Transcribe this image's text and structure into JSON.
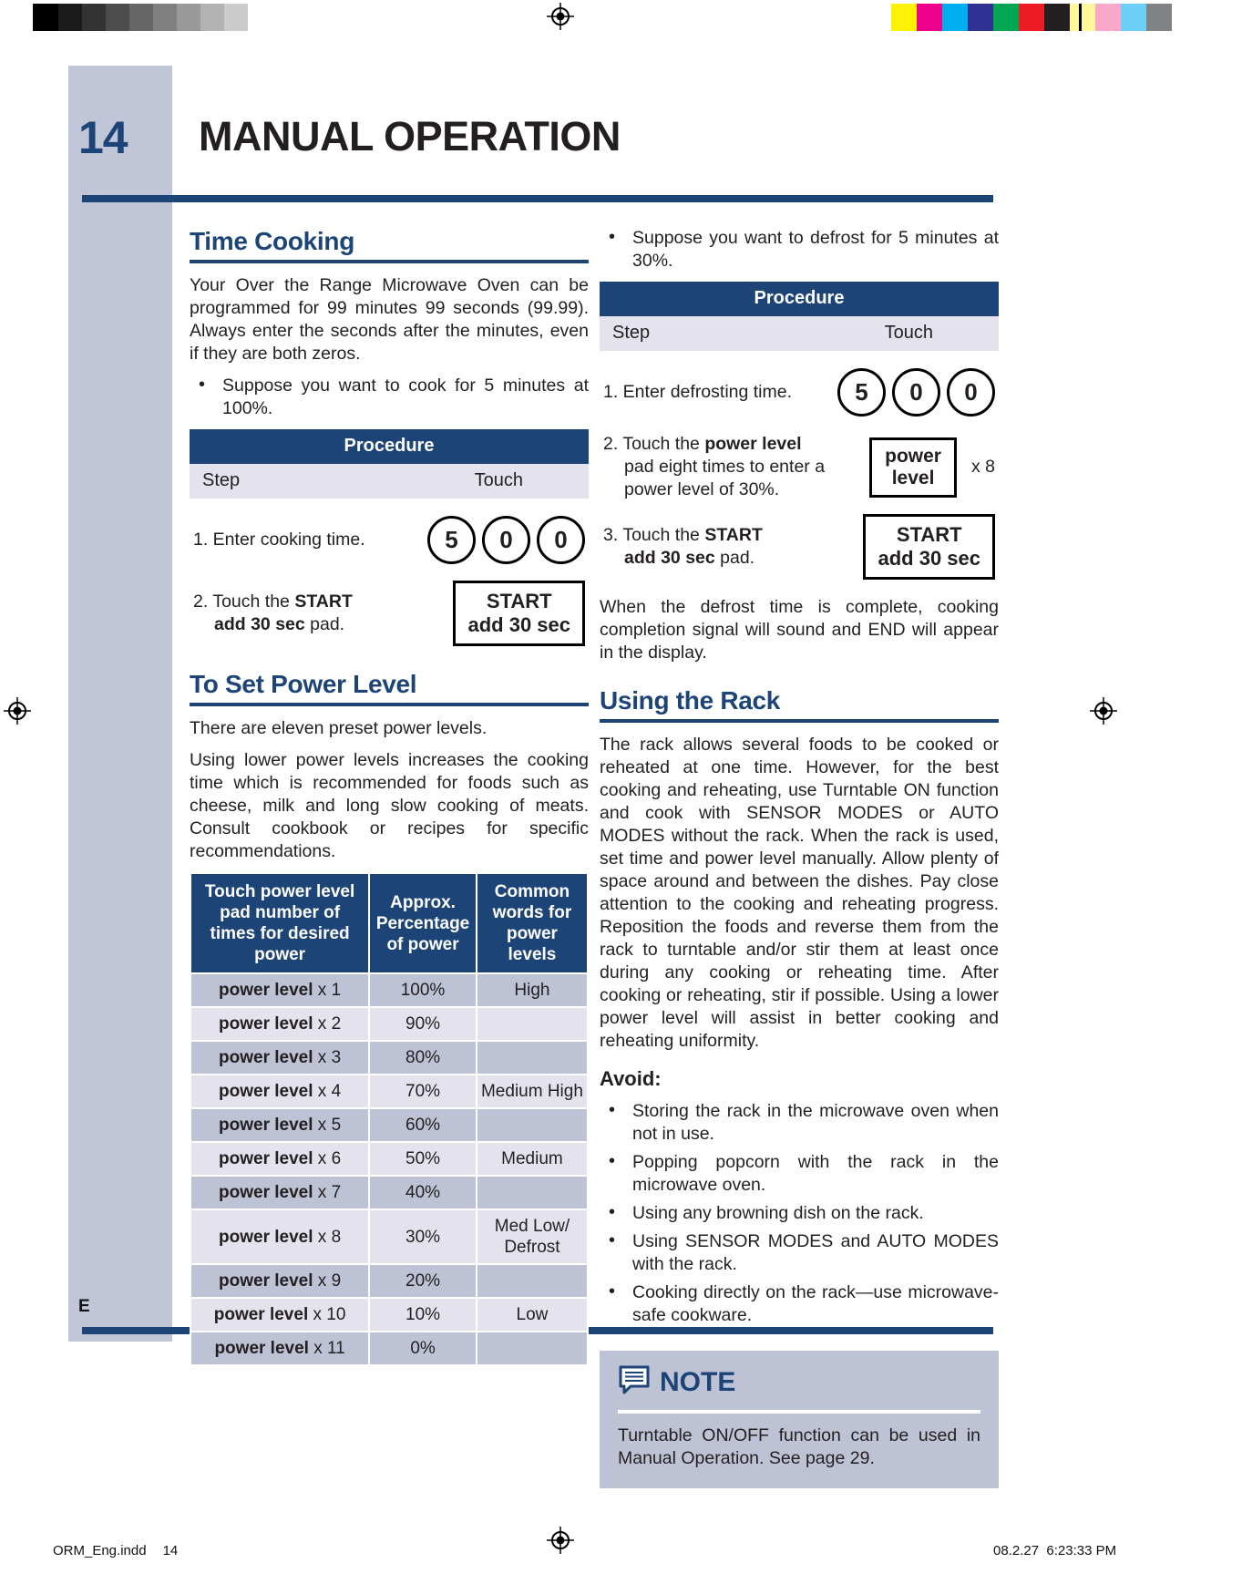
{
  "header": {
    "page_number": "14",
    "title": "MANUAL OPERATION",
    "edge_tab": "E"
  },
  "left_column": {
    "time_cooking": {
      "heading": "Time Cooking",
      "paragraph": "Your Over the Range Microwave Oven can be programmed for 99 minutes 99 seconds (99.99). Always enter the seconds after the minutes, even if they are both zeros.",
      "bullets": [
        "Suppose you want to cook for 5 minutes at 100%."
      ],
      "procedure": {
        "title": "Procedure",
        "col_step": "Step",
        "col_touch": "Touch",
        "rows": [
          {
            "step_text": "1. Enter cooking time.",
            "step_text2": "",
            "touch_type": "circles",
            "keys": [
              "5",
              "0",
              "0"
            ]
          },
          {
            "step_text": "2. Touch the START",
            "step_text2": "add 30 sec pad.",
            "touch_type": "box",
            "box_line1": "START",
            "box_line2": "add 30 sec"
          }
        ]
      }
    },
    "power_level": {
      "heading": "To Set Power Level",
      "paragraph1": "There are eleven preset power levels.",
      "paragraph2": "Using lower power levels increases the cooking time which is recommended for foods such as cheese, milk and long slow cooking of meats. Consult cookbook or recipes for specific recommendations.",
      "table": {
        "headers": [
          "Touch power level pad number of times for desired power",
          "Approx. Percentage of power",
          "Common words for power levels"
        ],
        "rows": [
          {
            "pad": "power level",
            "times": "x 1",
            "percent": "100%",
            "word": "High"
          },
          {
            "pad": "power level",
            "times": "x 2",
            "percent": "90%",
            "word": ""
          },
          {
            "pad": "power level",
            "times": "x 3",
            "percent": "80%",
            "word": ""
          },
          {
            "pad": "power level",
            "times": "x 4",
            "percent": "70%",
            "word": "Medium High"
          },
          {
            "pad": "power level",
            "times": "x 5",
            "percent": "60%",
            "word": ""
          },
          {
            "pad": "power level",
            "times": "x 6",
            "percent": "50%",
            "word": "Medium"
          },
          {
            "pad": "power level",
            "times": "x 7",
            "percent": "40%",
            "word": ""
          },
          {
            "pad": "power level",
            "times": "x 8",
            "percent": "30%",
            "word": "Med Low/ Defrost"
          },
          {
            "pad": "power level",
            "times": "x 9",
            "percent": "20%",
            "word": ""
          },
          {
            "pad": "power level",
            "times": "x 10",
            "percent": "10%",
            "word": "Low"
          },
          {
            "pad": "power level",
            "times": "x 11",
            "percent": "0%",
            "word": ""
          }
        ]
      }
    }
  },
  "right_column": {
    "defrost": {
      "bullets": [
        "Suppose you want to defrost for 5 minutes at 30%."
      ],
      "procedure": {
        "title": "Procedure",
        "col_step": "Step",
        "col_touch": "Touch",
        "rows": [
          {
            "step_text": "1. Enter defrosting time.",
            "step_text2": "",
            "touch_type": "circles",
            "keys": [
              "5",
              "0",
              "0"
            ]
          },
          {
            "step_text": "2. Touch the power level",
            "step_text2": "pad eight times to enter a power level of 30%.",
            "touch_type": "box_times",
            "box_line1": "power",
            "box_line2": "level",
            "times_label": "x 8"
          },
          {
            "step_text": "3. Touch the START",
            "step_text2": "add 30 sec pad.",
            "touch_type": "box",
            "box_line1": "START",
            "box_line2": "add 30 sec"
          }
        ]
      },
      "closing_paragraph": "When the defrost time is complete, cooking completion signal will sound and END will appear in the display."
    },
    "using_rack": {
      "heading": "Using the Rack",
      "paragraph": "The rack allows several foods to be cooked or reheated at one time. However, for the best cooking and reheating, use Turntable ON function and cook with SENSOR MODES or AUTO MODES without the rack. When the rack is used, set time and power level manually. Allow plenty of space around and between the dishes. Pay close attention to the cooking and reheating progress. Reposition the foods and reverse them from the rack to turntable and/or stir them at least once during any cooking or reheating time. After cooking or reheating, stir if possible. Using a lower power level will assist in better cooking and reheating uniformity.",
      "avoid_heading": "Avoid:",
      "avoid_bullets": [
        "Storing the rack in the microwave oven when not in use.",
        "Popping popcorn with the rack in the microwave oven.",
        "Using any browning dish on the rack.",
        "Using SENSOR MODES and AUTO MODES with the rack.",
        "Cooking directly on the rack—use microwave-safe cookware."
      ]
    },
    "note": {
      "icon": "note-bubble-icon",
      "title": "NOTE",
      "body": "Turntable ON/OFF function can be used in Manual Operation.  See page 29."
    }
  },
  "footer": {
    "file_name": "ORM_Eng.indd",
    "page": "14",
    "date": "08.2.27",
    "time": "6:23:33 PM"
  },
  "colors": {
    "navy": "#1d4477",
    "band": "#c0c5d8",
    "row_dark": "#bec2d5",
    "row_light": "#e4e3ed",
    "subheader": "#e4e3ed"
  },
  "calibration": {
    "grayscale": [
      "#000000",
      "#1a1a1a",
      "#333333",
      "#4d4d4d",
      "#666666",
      "#808080",
      "#999999",
      "#b3b3b3",
      "#cccccc",
      "#ffffff"
    ],
    "colors": [
      "#fff200",
      "#ec008c",
      "#00aeef",
      "#2e3192",
      "#00a651",
      "#ed1c24",
      "#231f20",
      "#fff79a",
      "#f9a8c9",
      "#6dcff6",
      "#808285"
    ]
  }
}
